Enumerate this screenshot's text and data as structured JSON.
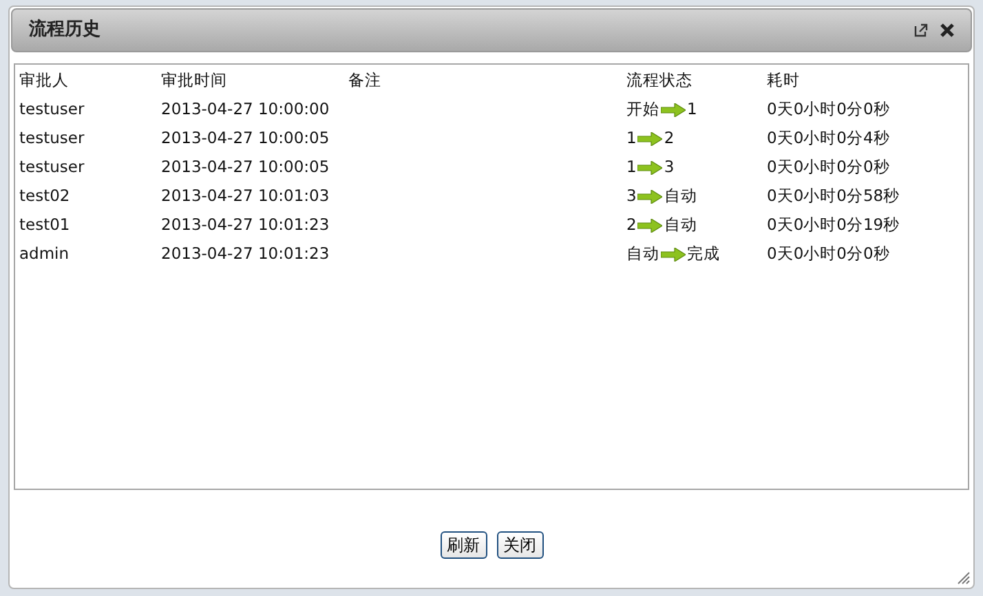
{
  "dialog": {
    "title": "流程历史"
  },
  "table": {
    "columns": [
      "审批人",
      "审批时间",
      "备注",
      "流程状态",
      "耗时"
    ],
    "rows": [
      {
        "approver": "testuser",
        "time": "2013-04-27 10:00:00",
        "status_from": "开始",
        "status_to": "1",
        "duration": "0天0小时0分0秒"
      },
      {
        "approver": "testuser",
        "time": "2013-04-27 10:00:05",
        "status_from": "1",
        "status_to": "2",
        "duration": "0天0小时0分4秒"
      },
      {
        "approver": "testuser",
        "time": "2013-04-27 10:00:05",
        "status_from": "1",
        "status_to": "3",
        "duration": "0天0小时0分0秒"
      },
      {
        "approver": "test02",
        "time": "2013-04-27 10:01:03",
        "status_from": "3",
        "status_to": "自动",
        "duration": "0天0小时0分58秒"
      },
      {
        "approver": "test01",
        "time": "2013-04-27 10:01:23",
        "status_from": "2",
        "status_to": "自动",
        "duration": "0天0小时0分19秒"
      },
      {
        "approver": "admin",
        "time": "2013-04-27 10:01:23",
        "status_from": "自动",
        "status_to": "完成",
        "duration": "0天0小时0分0秒"
      }
    ]
  },
  "buttons": [
    "刷新",
    "关闭"
  ]
}
